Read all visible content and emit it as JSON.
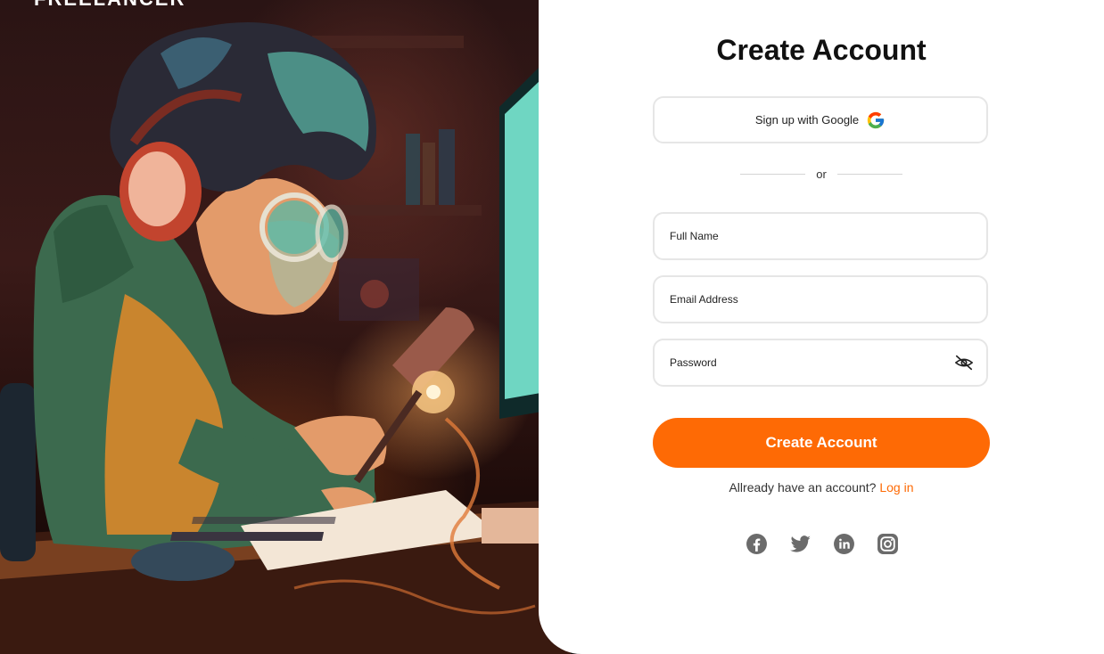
{
  "brand": {
    "name": "FREELANCER"
  },
  "form": {
    "title": "Create Account",
    "google_label": "Sign up with Google",
    "divider_text": "or",
    "full_name_placeholder": "Full Name",
    "email_placeholder": "Email Address",
    "password_placeholder": "Password",
    "submit_label": "Create Account",
    "login_prompt": "Allready have an account?",
    "login_link": "Log in"
  },
  "socials": [
    {
      "icon": "facebook-icon"
    },
    {
      "icon": "twitter-icon"
    },
    {
      "icon": "linkedin-icon"
    },
    {
      "icon": "instagram-icon"
    }
  ],
  "colors": {
    "accent": "#fe6a05",
    "panel_bg": "#ffffff",
    "social_icon": "#6b6b6b"
  }
}
